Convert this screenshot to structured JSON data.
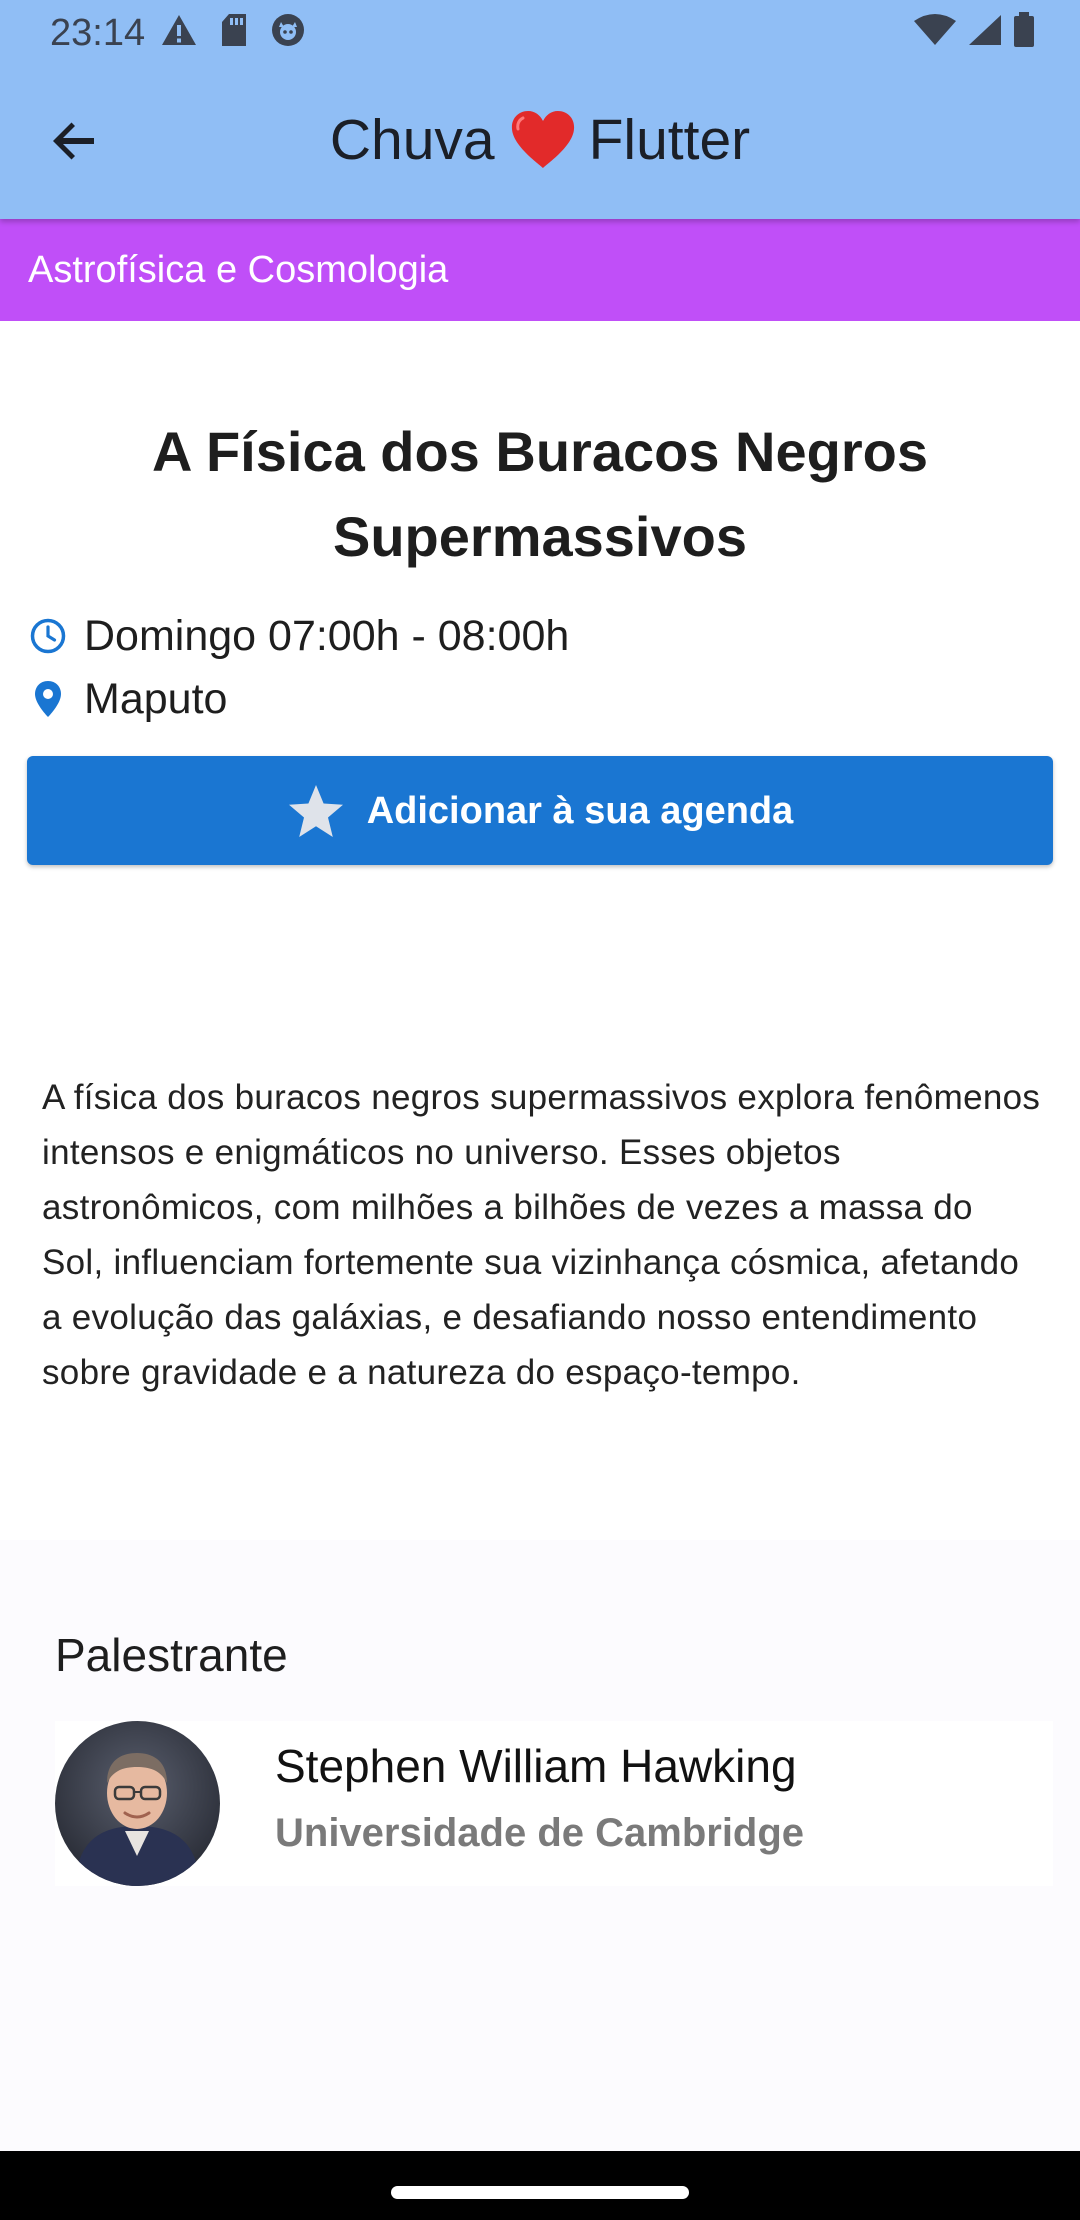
{
  "status_bar": {
    "time": "23:14",
    "left_icons": [
      "alert-icon",
      "sd-card-icon",
      "app-notification-icon"
    ],
    "right_icons": [
      "wifi-icon",
      "signal-icon",
      "battery-icon"
    ]
  },
  "app_bar": {
    "title_before": "Chuva",
    "title_icon": "heart-icon",
    "title_after": "Flutter",
    "back_icon": "arrow-back-icon",
    "background_color": "#90bef5"
  },
  "category": {
    "label": "Astrofísica e Cosmologia",
    "color": "#c04ff8"
  },
  "talk": {
    "title": "A Física dos Buracos Negros Supermassivos",
    "schedule": "Domingo 07:00h - 08:00h",
    "location": "Maputo",
    "add_button_label": "Adicionar à sua agenda",
    "button_color": "#1a76d2",
    "description": "A física dos buracos negros supermassivos explora fenômenos intensos e enigmáticos no universo. Esses objetos astronômicos, com milhões a bilhões de vezes a massa do Sol, influenciam fortemente sua vizinhança cósmica, afetando a evolução das galáxias, e desafiando nosso entendimento sobre gravidade e a natureza do espaço-tempo."
  },
  "speakers": {
    "heading": "Palestrante",
    "items": [
      {
        "name": "Stephen William Hawking",
        "institution": "Universidade de Cambridge"
      }
    ]
  }
}
